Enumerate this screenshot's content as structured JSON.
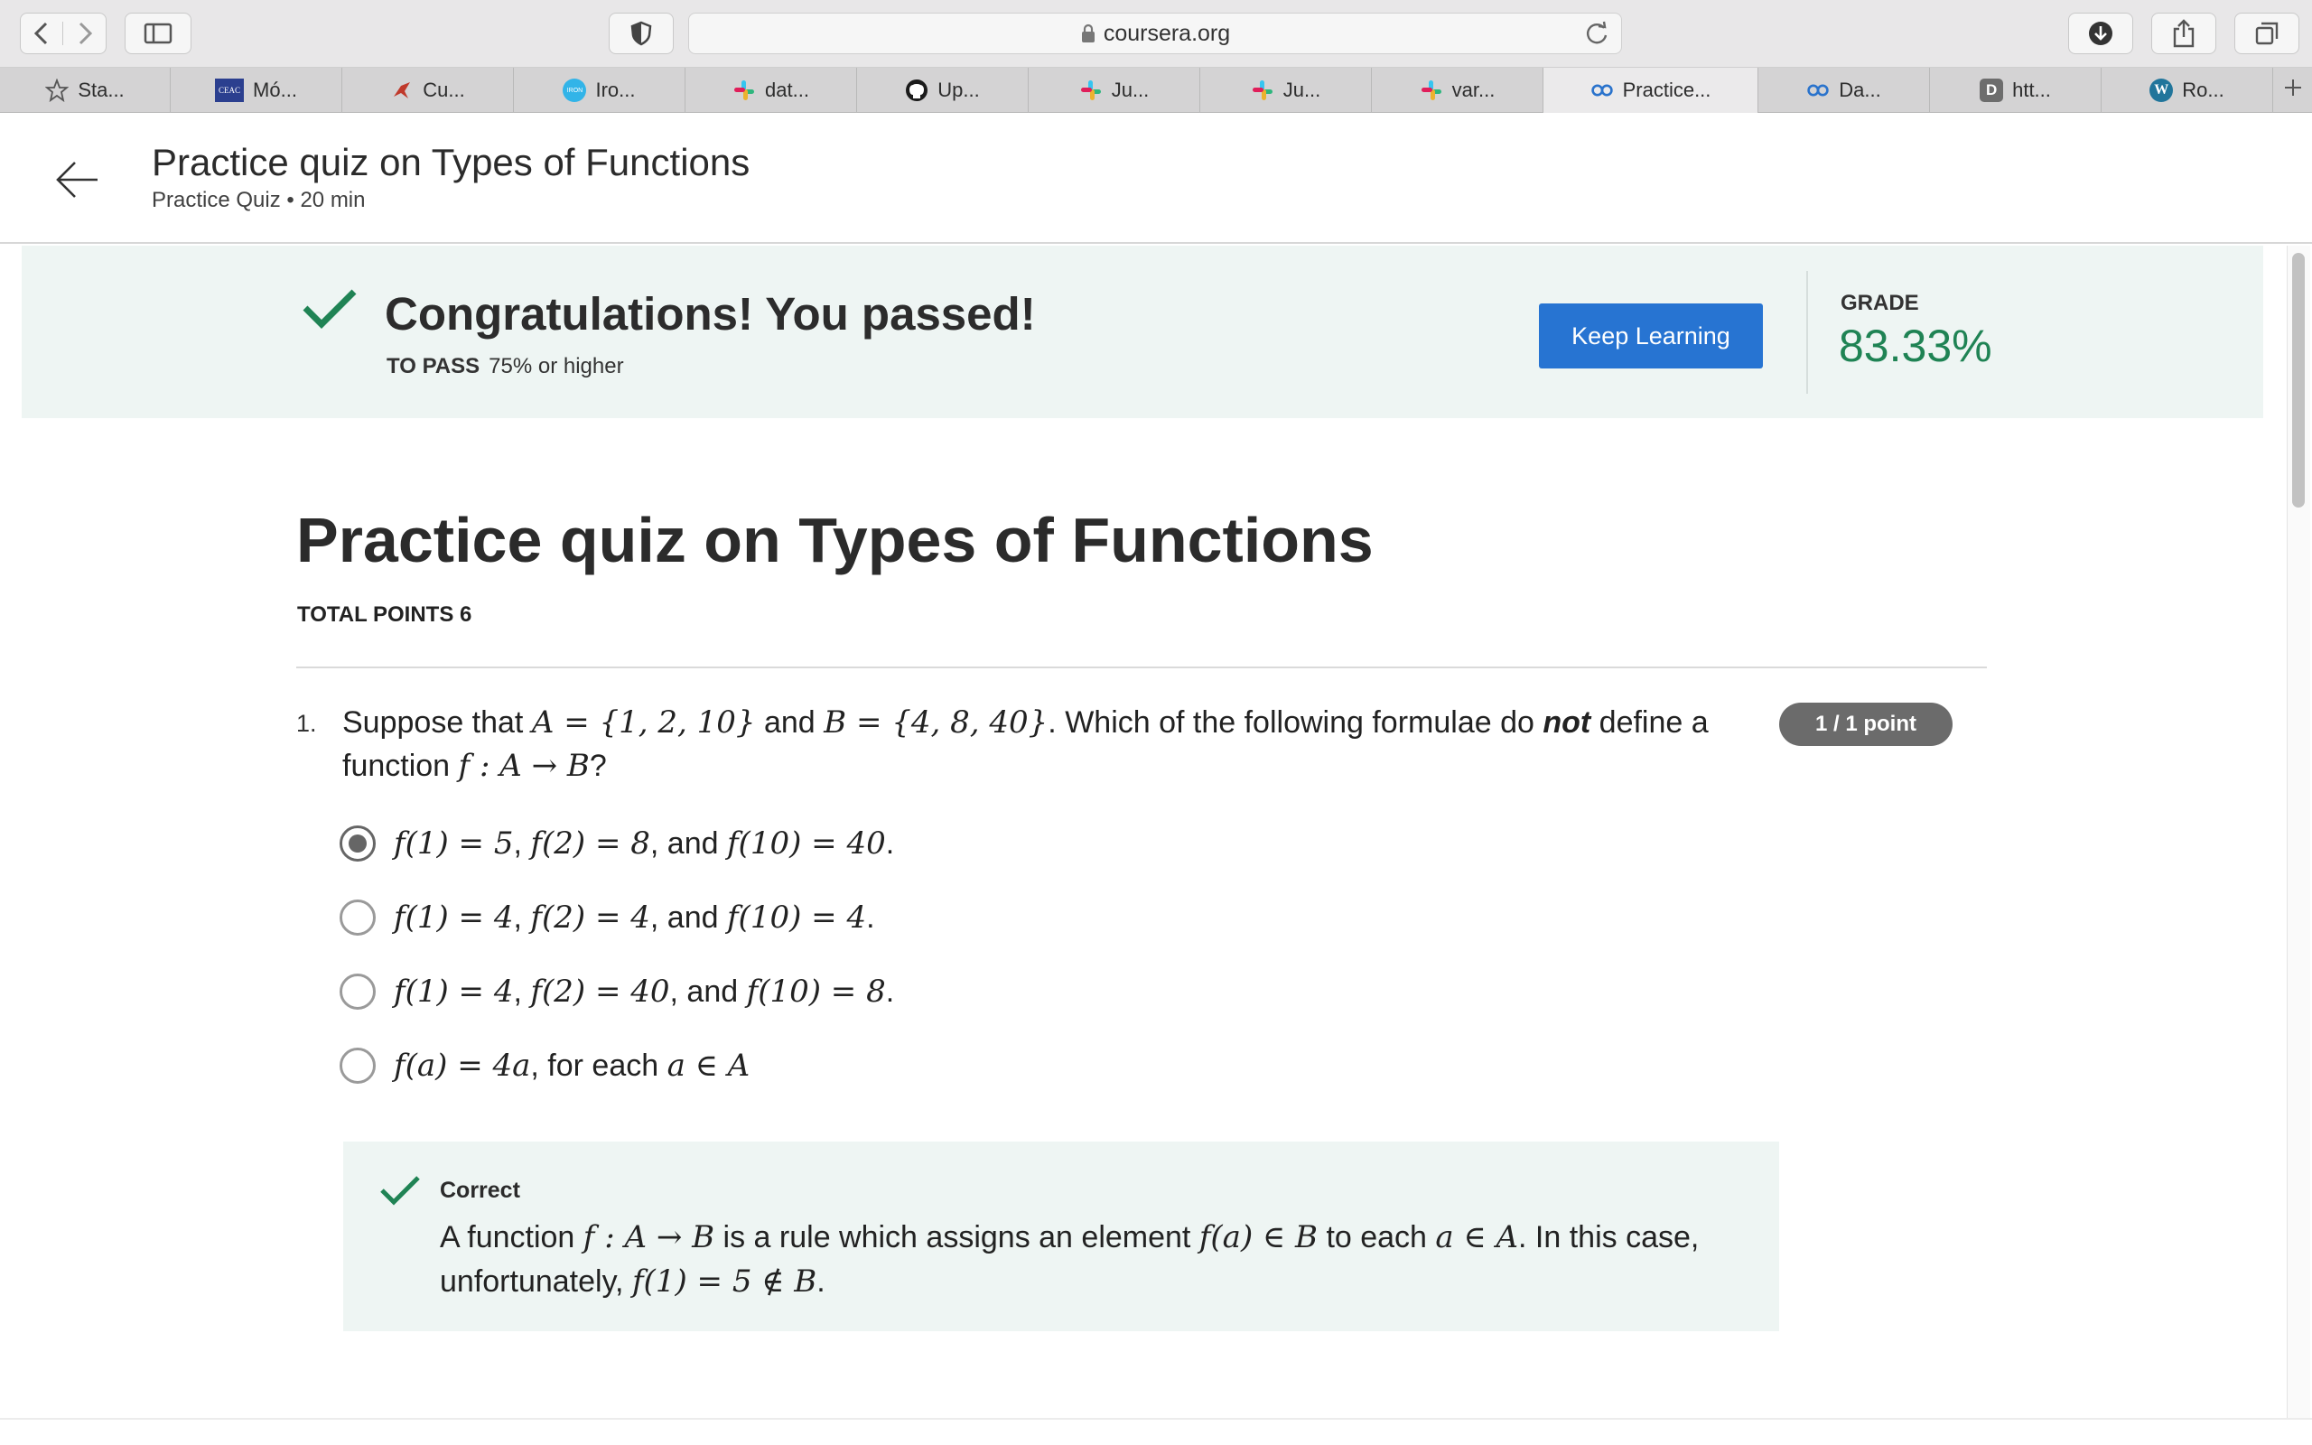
{
  "browser": {
    "url": "coursera.org",
    "tabs": [
      {
        "label": "Sta...",
        "icon": "star-icon"
      },
      {
        "label": "Mó...",
        "icon": "ceac-favicon"
      },
      {
        "label": "Cu...",
        "icon": "bird-favicon"
      },
      {
        "label": "Iro...",
        "icon": "ironhack-favicon"
      },
      {
        "label": "dat...",
        "icon": "slack-icon"
      },
      {
        "label": "Up...",
        "icon": "github-icon"
      },
      {
        "label": "Ju...",
        "icon": "slack-icon"
      },
      {
        "label": "Ju...",
        "icon": "slack-icon"
      },
      {
        "label": "var...",
        "icon": "slack-icon"
      },
      {
        "label": "Practice...",
        "icon": "coursera-icon",
        "active": true
      },
      {
        "label": "Da...",
        "icon": "coursera-icon"
      },
      {
        "label": "htt...",
        "icon": "d-favicon"
      },
      {
        "label": "Ro...",
        "icon": "wordpress-icon"
      }
    ]
  },
  "header": {
    "title": "Practice quiz on Types of Functions",
    "subtitle": "Practice Quiz • 20 min"
  },
  "banner": {
    "message": "Congratulations! You passed!",
    "to_pass_label": "TO PASS",
    "to_pass_value": "75% or higher",
    "button": "Keep Learning",
    "grade_label": "GRADE",
    "grade_value": "83.33%"
  },
  "quiz": {
    "title": "Practice quiz on Types of Functions",
    "total_points": "TOTAL POINTS 6",
    "question": {
      "number": "1.",
      "points": "1 / 1 point",
      "intro": "Suppose that",
      "and": "and",
      "which": ". Which of the following formulae do",
      "not": "not",
      "define": "define a function",
      "A_set": "A = {1, 2, 10}",
      "B_set": "B = {4, 8, 40}",
      "map": "f : A → B",
      "q_end": "?",
      "options": [
        {
          "a": "f(1) = 5",
          "b": "f(2) = 8",
          "c": "f(10) = 40",
          "end": ".",
          "selected": true
        },
        {
          "a": "f(1) = 4",
          "b": "f(2) = 4",
          "c": "f(10) = 4",
          "end": ".",
          "selected": false
        },
        {
          "a": "f(1) = 4",
          "b": "f(2) = 40",
          "c": "f(10) = 8",
          "end": ".",
          "selected": false
        }
      ],
      "option4": {
        "a": "f(a) = 4a",
        "text": "for each",
        "b": "a ∈ A"
      },
      "and_word": "and"
    },
    "feedback": {
      "label": "Correct",
      "t1": "A function",
      "m1": "f : A → B",
      "t2": "is a rule which assigns an element",
      "m2": "f(a) ∈ B",
      "t3": "to each",
      "m3": "a ∈ A",
      "t4": ". In this case, unfortunately,",
      "m4": "f(1) = 5 ∉ B",
      "t5": "."
    }
  },
  "colors": {
    "accent": "#2774d2",
    "success": "#1f8354",
    "banner_bg": "#eef5f3"
  }
}
